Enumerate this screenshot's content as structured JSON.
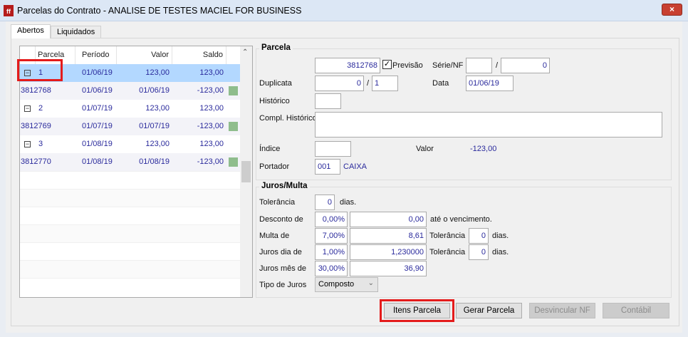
{
  "window": {
    "title": "Parcelas do Contrato - ANALISE DE TESTES MACIEL FOR BUSINESS",
    "close_icon": "×"
  },
  "tabs": [
    {
      "label": "Abertos"
    },
    {
      "label": "Liquidados"
    }
  ],
  "grid": {
    "columns": [
      "Parcela",
      "Período",
      "Valor",
      "Saldo"
    ],
    "rows": [
      {
        "type": "parcela",
        "parcela": "1",
        "periodo": "01/06/19",
        "valor": "123,00",
        "saldo": "123,00"
      },
      {
        "type": "item",
        "parcela": "3812768",
        "periodo": "01/06/19",
        "valor": "01/06/19",
        "saldo": "-123,00"
      },
      {
        "type": "parcela",
        "parcela": "2",
        "periodo": "01/07/19",
        "valor": "123,00",
        "saldo": "123,00"
      },
      {
        "type": "item",
        "parcela": "3812769",
        "periodo": "01/07/19",
        "valor": "01/07/19",
        "saldo": "-123,00"
      },
      {
        "type": "parcela",
        "parcela": "3",
        "periodo": "01/08/19",
        "valor": "123,00",
        "saldo": "123,00"
      },
      {
        "type": "item",
        "parcela": "3812770",
        "periodo": "01/08/19",
        "valor": "01/08/19",
        "saldo": "-123,00"
      }
    ],
    "status_color": "#8fbd8d"
  },
  "parcela": {
    "title": "Parcela",
    "numero": "3812768",
    "previsao_label": "Previsão",
    "previsao_checked": true,
    "serie_label": "Série/NF",
    "serie": "",
    "nf": "0",
    "duplicata_label": "Duplicata",
    "duplicata": "0",
    "duplicata_of": "1",
    "data_label": "Data",
    "data": "01/06/19",
    "historico_label": "Histórico",
    "historico": "",
    "compl_label": "Compl. Histórico",
    "compl": "",
    "indice_label": "Índice",
    "indice": "",
    "valor_label": "Valor",
    "valor": "-123,00",
    "portador_label": "Portador",
    "portador": "001",
    "portador_nome": "CAIXA"
  },
  "juros": {
    "title": "Juros/Multa",
    "tolerancia_label": "Tolerância",
    "tolerancia": "0",
    "dias": "dias.",
    "desconto_label": "Desconto de",
    "desconto_pct": "0,00%",
    "desconto_val": "0,00",
    "ate_venc": "até o vencimento.",
    "multa_label": "Multa de",
    "multa_pct": "7,00%",
    "multa_val": "8,61",
    "multa_tol": "0",
    "juros_dia_label": "Juros dia de",
    "juros_dia_pct": "1,00%",
    "juros_dia_val": "1,230000",
    "juros_dia_tol": "0",
    "juros_mes_label": "Juros mês de",
    "juros_mes_pct": "30,00%",
    "juros_mes_val": "36,90",
    "tipo_label": "Tipo de Juros",
    "tipo": "Composto"
  },
  "buttons": {
    "itens": "Itens Parcela",
    "gerar": "Gerar Parcela",
    "desvincular": "Desvincular NF",
    "contabil": "Contábil"
  }
}
